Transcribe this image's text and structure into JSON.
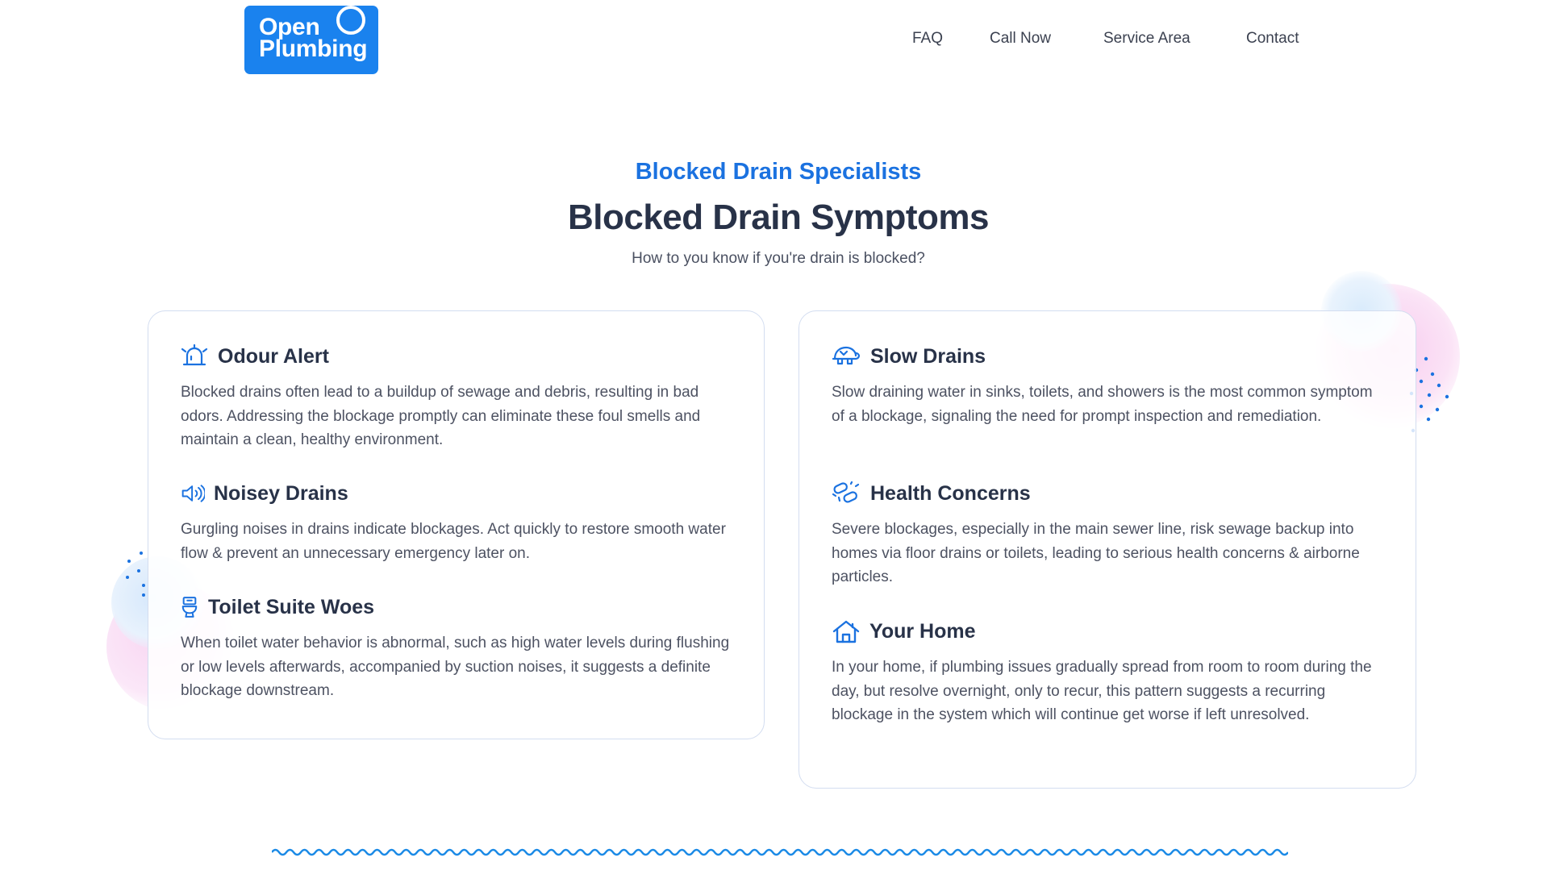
{
  "header": {
    "logo": {
      "line1": "Open",
      "line2": "Plumbing"
    },
    "nav": [
      {
        "label": "FAQ"
      },
      {
        "label": "Call Now"
      },
      {
        "label": "Service Area"
      },
      {
        "label": "Contact"
      }
    ]
  },
  "hero": {
    "eyebrow": "Blocked Drain Specialists",
    "title": "Blocked Drain Symptoms",
    "subtitle": "How to you know if you're drain is blocked?"
  },
  "cards": {
    "left": [
      {
        "icon": "siren-icon",
        "title": "Odour Alert",
        "body": "Blocked drains often lead to a buildup of sewage and debris, resulting in bad odors. Addressing the blockage promptly can eliminate these foul smells and maintain a clean, healthy environment."
      },
      {
        "icon": "speaker-icon",
        "title": "Noisey Drains",
        "body": "Gurgling noises in drains indicate blockages. Act quickly to restore smooth water flow & prevent an unnecessary emergency later on."
      },
      {
        "icon": "toilet-icon",
        "title": "Toilet Suite Woes",
        "body": "When toilet water behavior is abnormal, such as high water levels during flushing or low levels afterwards, accompanied by suction noises, it suggests a definite blockage downstream."
      }
    ],
    "right": [
      {
        "icon": "turtle-icon",
        "title": "Slow Drains",
        "body": "Slow draining water in sinks, toilets, and showers is the most common symptom of a blockage, signaling the need for prompt inspection and remediation."
      },
      {
        "icon": "bacteria-icon",
        "title": "Health Concerns",
        "body": "Severe blockages, especially in the main sewer line, risk sewage backup into homes via floor drains or toilets, leading to serious health concerns & airborne particles."
      },
      {
        "icon": "home-icon",
        "title": "Your Home",
        "body": "In your home, if plumbing issues gradually spread from room to room during the day, but resolve overnight, only to recur, this pattern suggests a recurring blockage in the system which will continue get worse if left unresolved."
      }
    ]
  },
  "colors": {
    "brand": "#1a82ee",
    "accent": "#1b72e0",
    "heading": "#283248",
    "border": "#d3ddf0"
  }
}
